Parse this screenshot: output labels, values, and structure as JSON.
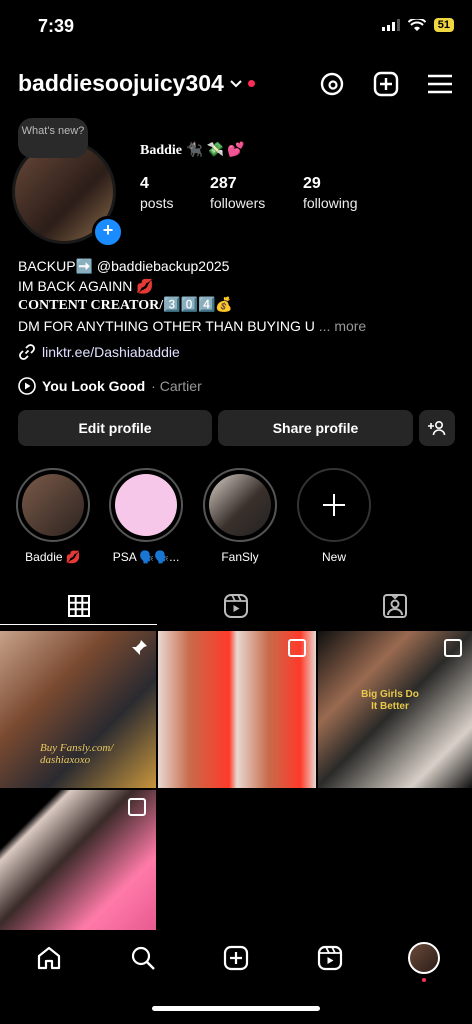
{
  "status": {
    "time": "7:39",
    "battery": "51"
  },
  "header": {
    "username": "baddiesoojuicy304"
  },
  "profile": {
    "note": "What's new?",
    "display_name": "Baddie 🐈‍⬛ 💸 💕",
    "stats": [
      {
        "value": "4",
        "label": "posts"
      },
      {
        "value": "287",
        "label": "followers"
      },
      {
        "value": "29",
        "label": "following"
      }
    ],
    "bio": {
      "line1": "BACKUP➡️ @baddiebackup2025",
      "line2": "IM BACK AGAINN 💋",
      "line3": "CONTENT CREATOR/3️⃣0️⃣4️⃣💰",
      "line4": "DM FOR ANYTHING OTHER THAN BUYING U",
      "more": "... more"
    },
    "link": "linktr.ee/Dashiabaddie",
    "music": {
      "song": "You Look Good",
      "artist": "· Cartier"
    }
  },
  "buttons": {
    "edit": "Edit profile",
    "share": "Share profile"
  },
  "highlights": [
    {
      "label": "Baddie 💋",
      "color": "#6b5040"
    },
    {
      "label": "PSA 🗣️🗣️...",
      "color": "#f6c7e8"
    },
    {
      "label": "FanSly",
      "color": "#4a3f3a"
    },
    {
      "label": "New",
      "color": ""
    }
  ],
  "tabs": [
    "grid-icon",
    "reels-icon",
    "tagged-icon"
  ],
  "posts": [
    {
      "caption": "Buy Fansly.com/ dashiaxoxo",
      "pinned": true
    },
    {
      "caption": "",
      "multi": true
    },
    {
      "caption": "Big Girls Do It Better",
      "multi": true
    },
    {
      "caption": "",
      "multi": true
    }
  ],
  "nav": [
    "home-icon",
    "search-icon",
    "create-icon",
    "reels-icon",
    "profile-avatar"
  ]
}
